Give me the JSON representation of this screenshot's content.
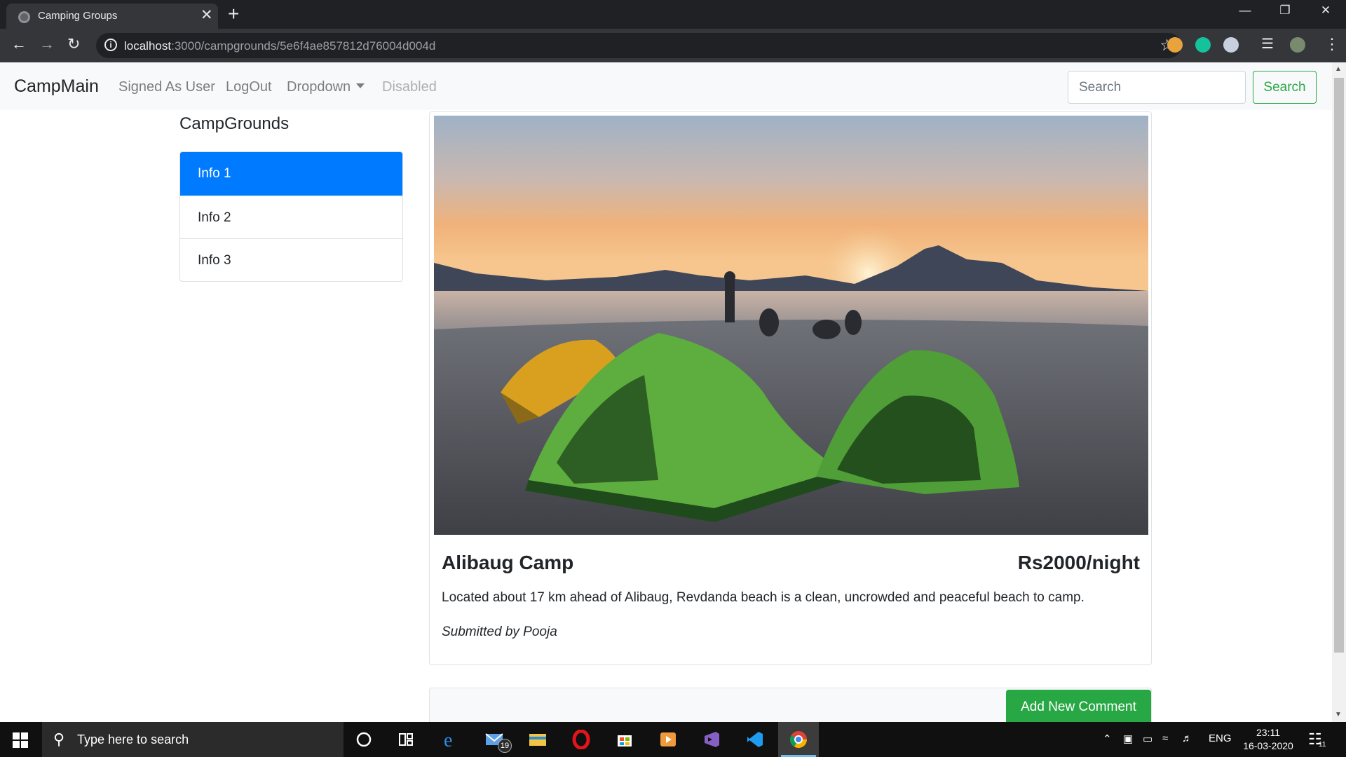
{
  "browser": {
    "tab_title": "Camping Groups",
    "tab_close": "✕",
    "new_tab": "+",
    "url_host": "localhost",
    "url_path": ":3000/campgrounds/5e6f4ae857812d76004d004d"
  },
  "navbar": {
    "brand": "CampMain",
    "links": [
      "Signed As User",
      "LogOut",
      "Dropdown",
      "Disabled"
    ],
    "search_placeholder": "Search",
    "search_button": "Search"
  },
  "sidebar": {
    "heading": "CampGrounds",
    "items": [
      "Info 1",
      "Info 2",
      "Info 3"
    ],
    "active_index": 0
  },
  "campground": {
    "title": "Alibaug Camp",
    "price": "Rs2000/night",
    "description": "Located about 17 km ahead of Alibaug, Revdanda beach is a clean, uncrowded and peaceful beach to camp.",
    "author": "Submitted by Pooja"
  },
  "comments": {
    "add_button": "Add New Comment"
  },
  "taskbar": {
    "search_placeholder": "Type here to search",
    "mail_badge": "19",
    "language": "ENG",
    "time": "23:11",
    "date": "16-03-2020",
    "notification_count": "11"
  },
  "colors": {
    "primary": "#007bff",
    "success": "#28a745",
    "navbar_bg": "#f8f9fa",
    "chrome_dark": "#202124"
  },
  "icons": [
    "back-icon",
    "forward-icon",
    "reload-icon",
    "info-icon",
    "star-icon",
    "menu-icon",
    "windows-start-icon",
    "search-icon",
    "cortana-icon",
    "task-view-icon",
    "edge-icon",
    "mail-icon",
    "file-explorer-icon",
    "opera-icon",
    "store-icon",
    "media-player-icon",
    "visual-studio-icon",
    "vscode-icon",
    "chrome-icon"
  ]
}
